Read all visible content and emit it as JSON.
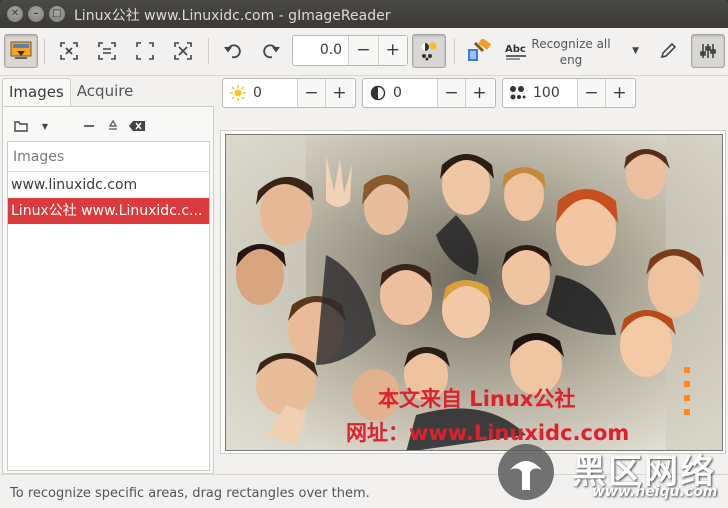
{
  "window": {
    "title": "Linux公社 www.Linuxidc.com - gImageReader"
  },
  "toolbar": {
    "rotation_value": "0.0",
    "minus": "−",
    "plus": "+",
    "recognize_label": "Recognize all",
    "recognize_lang": "eng",
    "buttons": [
      "sources-toggle-icon",
      "autolayout-icon",
      "select-region-icon",
      "zoom-fit-icon",
      "zoom-original-icon",
      "rotate-left-icon",
      "rotate-right-icon",
      "image-controls-icon",
      "ocr-mode-icon",
      "abc-icon",
      "edit-icon",
      "settings-icon"
    ]
  },
  "left_panel": {
    "tabs": [
      "Images",
      "Acquire"
    ],
    "list_header": "Images",
    "items": [
      "www.linuxidc.com",
      "Linux公社 www.Linuxidc.c..."
    ],
    "selected_index": 1
  },
  "adjustments": {
    "brightness": "0",
    "contrast": "0",
    "resolution": "100",
    "minus": "−",
    "plus": "+"
  },
  "watermark": {
    "line1": "本文来自 Linux公社",
    "line2": "网址：www.Linuxidc.com",
    "site_cn": "黑区网络",
    "site_url": "www.heiqu.com"
  },
  "status": {
    "text": "To recognize specific areas, drag rectangles over them."
  },
  "colors": {
    "accent": "#dd3b3b",
    "titlebar": "#3c3b37",
    "watermark_red": "#e0202c"
  }
}
